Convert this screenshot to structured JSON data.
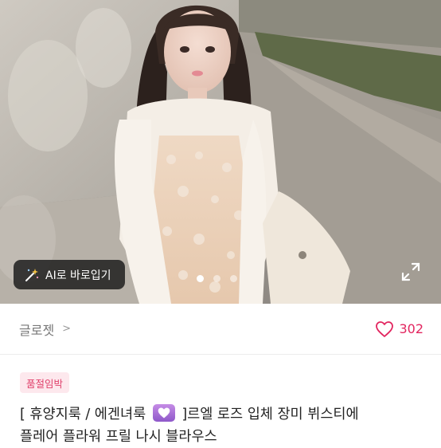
{
  "hero": {
    "ai_button_label": "AI로 바로입기",
    "carousel": {
      "total": 3,
      "active_index": 0
    },
    "icons": {
      "ai": "magic-wand-icon",
      "expand": "expand-icon"
    }
  },
  "seller": {
    "name": "글로젯",
    "chevron": ">"
  },
  "likes": {
    "count": "302",
    "icon": "heart-outline-icon",
    "color": "#e2255f"
  },
  "product": {
    "badge": "품절임박",
    "title_prefix": "[ 휴양지룩 / 에겐녀룩 ",
    "title_suffix": " ]르엘 로즈 입체 장미 뷔스티에",
    "title_line2": "플레어 플라워 프릴 나시 블라우스",
    "emoji": "purple-heart-emoji"
  },
  "colors": {
    "accent": "#e2255f",
    "badge_bg": "#fde8ed",
    "badge_text": "#e0426c"
  }
}
